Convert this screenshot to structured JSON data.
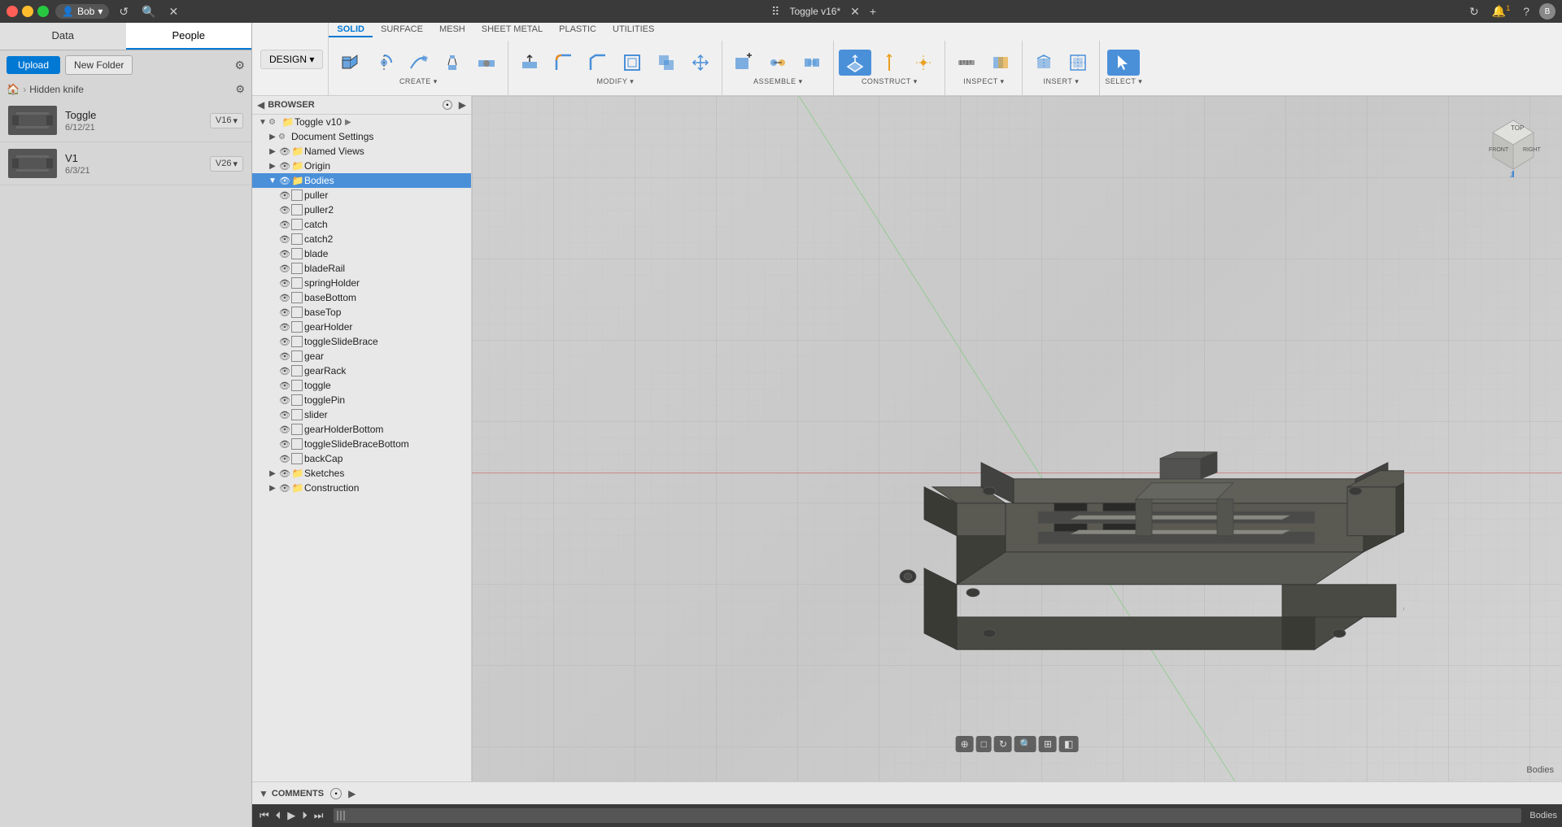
{
  "topbar": {
    "user": "Bob",
    "title": "Toggle v16*",
    "refresh_icon": "↺",
    "search_icon": "🔍",
    "close_icon": "✕",
    "menu_icon": "⠿",
    "notification_count": "1",
    "add_icon": "+",
    "apps_icon": "⠿"
  },
  "left_panel": {
    "tab_data": "Data",
    "tab_people": "People",
    "upload_label": "Upload",
    "new_folder_label": "New Folder",
    "breadcrumb_home": "🏠",
    "breadcrumb_folder": "Hidden knife",
    "files": [
      {
        "name": "Toggle",
        "date": "6/12/21",
        "version": "V16",
        "thumb_color": "#555"
      },
      {
        "name": "V1",
        "date": "6/3/21",
        "version": "V26",
        "thumb_color": "#555"
      }
    ]
  },
  "toolbar": {
    "tabs": [
      "SOLID",
      "SURFACE",
      "MESH",
      "SHEET METAL",
      "PLASTIC",
      "UTILITIES"
    ],
    "active_tab": "SOLID",
    "design_label": "DESIGN ▾",
    "groups": {
      "create": {
        "label": "CREATE ▾",
        "tools": [
          "new_component",
          "extrude",
          "revolve",
          "sweep",
          "loft",
          "rib",
          "web",
          "hole",
          "fillet",
          "thread"
        ]
      },
      "modify": {
        "label": "MODIFY ▾",
        "tools": [
          "press_pull",
          "fillet_m",
          "chamfer",
          "shell",
          "draft",
          "scale",
          "combine",
          "split_face",
          "split_body",
          "silhouette_split",
          "move",
          "align",
          "delete"
        ]
      },
      "assemble": {
        "label": "ASSEMBLE ▾",
        "tools": [
          "new_component_a",
          "joint",
          "as_built_joint",
          "joint_origin",
          "rigid_group",
          "drive_joints",
          "motion_link"
        ]
      },
      "construct": {
        "label": "CONSTRUCT ▾",
        "tools": [
          "offset_plane",
          "plane_at_angle",
          "plane_through_two",
          "plane_through_three",
          "plane_tangent",
          "plane_along_path",
          "midplane",
          "axis_through_cyl",
          "axis_perp_to_face",
          "axis_through_two",
          "axis_through_three",
          "axis_perp_at_point",
          "point_at_vertex",
          "point_through_two",
          "point_center",
          "point_at_edge"
        ]
      },
      "inspect": {
        "label": "INSPECT ▾",
        "tools": [
          "measure",
          "interference",
          "curvature_comb",
          "zebra_analysis",
          "draft_analysis",
          "curvature_map",
          "accessibility",
          "thickness"
        ]
      },
      "insert": {
        "label": "INSERT ▾",
        "tools": [
          "insert_mesh",
          "insert_svg",
          "insert_dxf",
          "insert_decal",
          "canvas",
          "attached_canvas",
          "insert_mcad"
        ]
      },
      "select": {
        "label": "SELECT ▾",
        "tools": [
          "select"
        ]
      }
    }
  },
  "browser": {
    "label": "BROWSER",
    "tree": {
      "root": "Toggle v10",
      "items": [
        {
          "label": "Document Settings",
          "type": "settings",
          "depth": 1,
          "expanded": false
        },
        {
          "label": "Named Views",
          "type": "folder",
          "depth": 1,
          "expanded": false
        },
        {
          "label": "Origin",
          "type": "folder",
          "depth": 1,
          "expanded": false
        },
        {
          "label": "Bodies",
          "type": "bodies",
          "depth": 1,
          "expanded": true,
          "selected": true
        },
        {
          "label": "puller",
          "type": "body",
          "depth": 2
        },
        {
          "label": "puller2",
          "type": "body",
          "depth": 2
        },
        {
          "label": "catch",
          "type": "body",
          "depth": 2
        },
        {
          "label": "catch2",
          "type": "body",
          "depth": 2
        },
        {
          "label": "blade",
          "type": "body",
          "depth": 2
        },
        {
          "label": "bladeRail",
          "type": "body",
          "depth": 2
        },
        {
          "label": "springHolder",
          "type": "body",
          "depth": 2
        },
        {
          "label": "baseBottom",
          "type": "body",
          "depth": 2
        },
        {
          "label": "baseTop",
          "type": "body",
          "depth": 2
        },
        {
          "label": "gearHolder",
          "type": "body",
          "depth": 2
        },
        {
          "label": "toggleSlideBrace",
          "type": "body",
          "depth": 2
        },
        {
          "label": "gear",
          "type": "body",
          "depth": 2
        },
        {
          "label": "gearRack",
          "type": "body",
          "depth": 2
        },
        {
          "label": "toggle",
          "type": "body",
          "depth": 2
        },
        {
          "label": "togglePin",
          "type": "body",
          "depth": 2
        },
        {
          "label": "slider",
          "type": "body",
          "depth": 2
        },
        {
          "label": "gearHolderBottom",
          "type": "body",
          "depth": 2
        },
        {
          "label": "toggleSlideBraceBottom",
          "type": "body",
          "depth": 2
        },
        {
          "label": "backCap",
          "type": "body",
          "depth": 2
        },
        {
          "label": "Sketches",
          "type": "sketch-folder",
          "depth": 1,
          "expanded": false
        },
        {
          "label": "Construction",
          "type": "construction-folder",
          "depth": 1,
          "expanded": false
        }
      ]
    }
  },
  "comments": {
    "label": "COMMENTS"
  },
  "viewport": {
    "status_label": "Bodies"
  },
  "bottom_bar": {
    "tools": [
      "⏮",
      "⏴",
      "▶",
      "⏵",
      "⏭"
    ]
  }
}
